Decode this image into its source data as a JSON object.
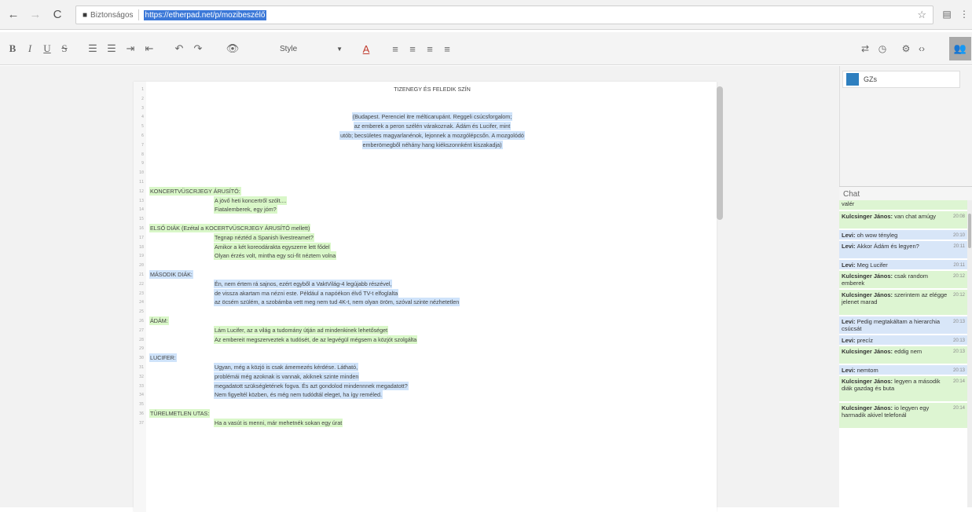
{
  "browser": {
    "secure_label": "Biztonságos",
    "url": "https://etherpad.net/p/mozibeszélő"
  },
  "toolbar": {
    "bold": "B",
    "italic": "I",
    "underline": "U",
    "strike": "S",
    "style_label": "Style"
  },
  "editor": {
    "lines": [
      {
        "n": "1",
        "text": "TIZENEGY ÉS FELEDIK SZÍN",
        "style": "plain",
        "align": "center"
      },
      {
        "n": "2",
        "text": "",
        "style": "plain"
      },
      {
        "n": "3",
        "text": "",
        "style": "plain"
      },
      {
        "n": "4",
        "text": "(Budapest. Perenciel itre mélticarupánt. Reggeli csúcsforgalom;",
        "style": "blue",
        "align": "center"
      },
      {
        "n": "5",
        "text": "az emberek a peron szélén várakoznak. Ádám és Lucifer, mint",
        "style": "blue",
        "align": "center"
      },
      {
        "n": "6",
        "text": "utób; becsületes magyarlanénok, lejonnek a mozgólépcsőn. A mozgolódó",
        "style": "blue",
        "align": "center"
      },
      {
        "n": "7",
        "text": "emberömegből néhány hang kiékszonnként kiszakadja)",
        "style": "blue",
        "align": "center"
      },
      {
        "n": "8",
        "text": "",
        "style": "plain"
      },
      {
        "n": "9",
        "text": "",
        "style": "plain"
      },
      {
        "n": "10",
        "text": "",
        "style": "plain"
      },
      {
        "n": "11",
        "text": "",
        "style": "plain"
      },
      {
        "n": "12",
        "text": "KONCERTVÜSCRJEGY ÁRUSÍTÓ:",
        "style": "green",
        "indent": 0
      },
      {
        "n": "13",
        "text": "A jövő heti koncertről szólt....",
        "style": "green",
        "indent": 1
      },
      {
        "n": "14",
        "text": "Fiatalemberek, egy jóm?",
        "style": "green",
        "indent": 1
      },
      {
        "n": "15",
        "text": "",
        "style": "plain"
      },
      {
        "n": "16",
        "text": "ELSŐ DIÁK (Ezétal a KOCERTVÜSCRJEGY ÁRUSÍTÓ mellett)",
        "style": "green",
        "indent": 0
      },
      {
        "n": "17",
        "text": "Tegnap néztéd a Spanish livestreamet?",
        "style": "green",
        "indent": 1
      },
      {
        "n": "18",
        "text": "Amikor a két koreodárakta egyszerre lett fődel",
        "style": "green",
        "indent": 1
      },
      {
        "n": "19",
        "text": "Olyan érzés volt, mintha egy sci-fit néztem volna",
        "style": "green",
        "indent": 1
      },
      {
        "n": "20",
        "text": "",
        "style": "plain"
      },
      {
        "n": "21",
        "text": "MÁSODIK DIÁK:",
        "style": "blue",
        "indent": 0
      },
      {
        "n": "22",
        "text": "Én, nem értem rá sajnos, ezért egyből a VaktVilág-4 legújabb részével,",
        "style": "blue",
        "indent": 1
      },
      {
        "n": "23",
        "text": "de vissza akartam ma nézni este. Például a napóékon élvő TV-t elfoglalta",
        "style": "blue",
        "indent": 1
      },
      {
        "n": "24",
        "text": "az öcsém szülém, a szobámba vett meg nem tud 4K-t, nem olyan öröm, szóval szinte nézhetetlen",
        "style": "blue",
        "indent": 1
      },
      {
        "n": "25",
        "text": "",
        "style": "plain"
      },
      {
        "n": "26",
        "text": "ÁDÁM:",
        "style": "green",
        "indent": 0
      },
      {
        "n": "27",
        "text": "Lám Lucifer, az a világ a tudomány útján ad mindenkinek lehetőséget",
        "style": "green",
        "indent": 1
      },
      {
        "n": "28",
        "text": "Az embereit megszerveztek a tudósét, de az legvégül mégsem a közjót szolgálta",
        "style": "green",
        "indent": 1
      },
      {
        "n": "29",
        "text": "",
        "style": "plain"
      },
      {
        "n": "30",
        "text": "LUCIFER:",
        "style": "blue",
        "indent": 0
      },
      {
        "n": "31",
        "text": "Ugyan, még a közjó is csak ámemezés kérdése. Látható,",
        "style": "blue",
        "indent": 1
      },
      {
        "n": "32",
        "text": "problémái még azoknak is vannak, akiknek szinte minden",
        "style": "blue",
        "indent": 1
      },
      {
        "n": "33",
        "text": "megadatott szükségletének fogva. És azt gondolod mindennnek megadatott?",
        "style": "blue",
        "indent": 1
      },
      {
        "n": "34",
        "text": "Nem figyeltél közben, és még nem tudódtál eleget, ha így reméled.",
        "style": "blue",
        "indent": 1
      },
      {
        "n": "35",
        "text": "",
        "style": "plain"
      },
      {
        "n": "36",
        "text": "TÜRELMETLEN UTAS:",
        "style": "green",
        "indent": 0
      },
      {
        "n": "37",
        "text": "Ha a vasút is menni, már mehetnék sokan egy úrat",
        "style": "green",
        "indent": 1
      }
    ]
  },
  "users": [
    {
      "name": "GZs",
      "color": "#2e7fbf"
    }
  ],
  "chat": {
    "title": "Chat",
    "messages": [
      {
        "author": "",
        "text": "valér",
        "time": "",
        "color": "green"
      },
      {
        "author": "Kulcsinger János:",
        "text": "van chat amúgy",
        "time": "20:08",
        "color": "green"
      },
      {
        "author": "Levi:",
        "text": "oh wow tényleg",
        "time": "20:10",
        "color": "blue"
      },
      {
        "author": "Levi:",
        "text": "Akkor Ádám és legyen?",
        "time": "20:11",
        "color": "blue"
      },
      {
        "author": "Levi:",
        "text": "Meg Lucifer",
        "time": "20:11",
        "color": "blue"
      },
      {
        "author": "Kulcsinger János:",
        "text": "csak random emberek",
        "time": "20:12",
        "color": "green"
      },
      {
        "author": "Kulcsinger János:",
        "text": "szerintem az elégge jelenet marad",
        "time": "20:12",
        "color": "green"
      },
      {
        "author": "Levi:",
        "text": "Pedig megtakáltam a hierarchia csúcsát",
        "time": "20:13",
        "color": "blue"
      },
      {
        "author": "Levi:",
        "text": "precíz",
        "time": "20:13",
        "color": "blue"
      },
      {
        "author": "Kulcsinger János:",
        "text": "eddig nem",
        "time": "20:13",
        "color": "green"
      },
      {
        "author": "Levi:",
        "text": "nemtom",
        "time": "20:13",
        "color": "blue"
      },
      {
        "author": "Kulcsinger János:",
        "text": "legyen a második diák gazdag és buta",
        "time": "20:14",
        "color": "green"
      },
      {
        "author": "Kulcsinger János:",
        "text": "io legyen egy harmadik akivel telefonál",
        "time": "20:14",
        "color": "green"
      }
    ]
  }
}
